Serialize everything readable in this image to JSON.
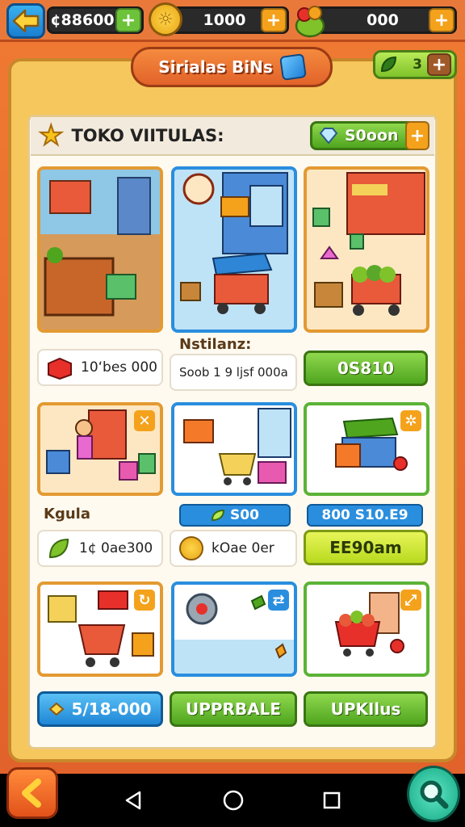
{
  "topbar": {
    "back_icon": "arrow-left-icon",
    "resource1_value": "¢88600",
    "resource1_plus": "+",
    "resource2_value": "1000",
    "resource2_plus": "+",
    "resource3_value": "000",
    "resource3_plus": "+"
  },
  "title": {
    "text": "Sirialas BiNs",
    "side_value": "3",
    "side_plus": "+"
  },
  "shop": {
    "title": "TOKO VIITULAS:",
    "header_button": "S0oon",
    "header_plus": "+"
  },
  "section1": {
    "caption": "Nstilanz:",
    "price_left": "10‘bes 000",
    "price_mid": "Soob 1 9 ljsf 000a",
    "button": "0S810"
  },
  "section2": {
    "caption": "Kgula",
    "chip_mid": "S00",
    "chip_right": "800 S10.E9",
    "price_left": "1¢ 0ae300",
    "price_mid": "kOae 0er",
    "button": "EE90am"
  },
  "section3": {
    "button_left": "5/18-000",
    "button_mid": "UPPRBALE",
    "button_right": "UPKIlus"
  },
  "colors": {
    "accent_green": "#4fa51e",
    "accent_blue": "#1f86d6",
    "panel": "#f6c75c",
    "bar": "#e9793a"
  }
}
